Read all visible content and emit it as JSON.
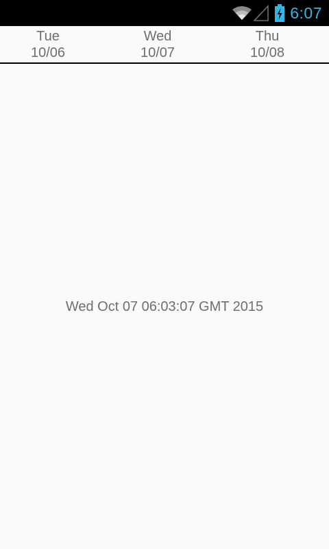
{
  "status_bar": {
    "time": "6:07",
    "time_color": "#33b5e5",
    "icons": [
      "wifi-icon",
      "signal-icon",
      "battery-charging-icon"
    ]
  },
  "day_tabs": [
    {
      "day": "Tue",
      "date": "10/06"
    },
    {
      "day": "Wed",
      "date": "10/07"
    },
    {
      "day": "Thu",
      "date": "10/08"
    }
  ],
  "selected_date_text": "Wed Oct 07 06:03:07 GMT 2015"
}
